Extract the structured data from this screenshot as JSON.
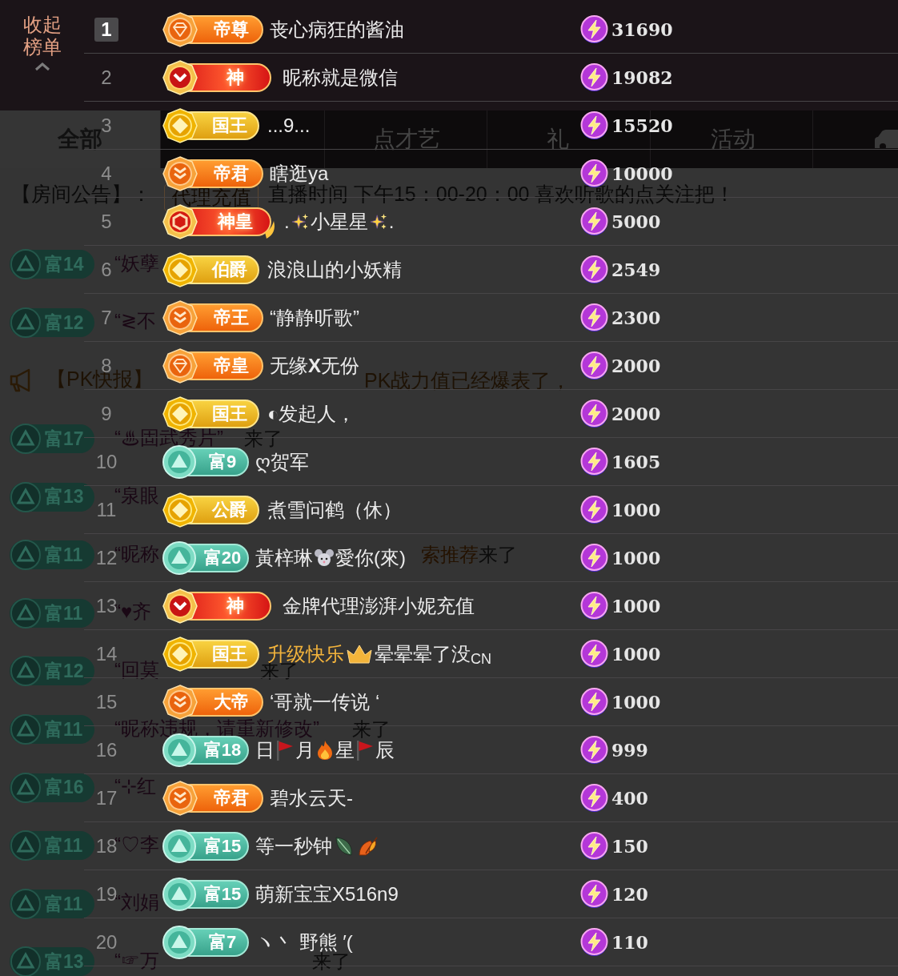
{
  "collapse_button": {
    "label": "收起榜单"
  },
  "tabs": [
    {
      "kind": "text",
      "label": "全部",
      "selected": true
    },
    {
      "kind": "text",
      "selected": false
    },
    {
      "kind": "text",
      "label": "点才艺",
      "selected": false
    },
    {
      "kind": "text",
      "label": "礼",
      "selected": false
    },
    {
      "kind": "text",
      "label": "活动",
      "selected": false
    },
    {
      "kind": "car",
      "selected": false
    }
  ],
  "announcement": {
    "label": "【房间公告】：",
    "tag": "代理充值",
    "text": "直播时间 下午15：00-20：00 喜欢听歌的点关注把！"
  },
  "chat": [
    {
      "kind": "entry",
      "badge": "富14",
      "name": "“妖孽"
    },
    {
      "kind": "entry",
      "badge": "富12",
      "name": "“≷不"
    },
    {
      "kind": "notice",
      "text": "【PK快报】",
      "tail": "PK战力值已经爆表了，"
    },
    {
      "kind": "entry",
      "badge": "富17",
      "name": "“♨固武秀片”",
      "suffix": "来了"
    },
    {
      "kind": "entry",
      "badge": "富13",
      "name": "“泉眼"
    },
    {
      "kind": "entry",
      "badge": "富11",
      "name": "“昵称",
      "source": "索推荐",
      "suffix": "来了"
    },
    {
      "kind": "entry",
      "badge": "富11",
      "name": "“♥齐"
    },
    {
      "kind": "entry",
      "badge": "富12",
      "name": "“回莫",
      "suffix": "来了"
    },
    {
      "kind": "entry",
      "badge": "富11",
      "name": "“昵称违规，请重新修改”",
      "suffix": "来了"
    },
    {
      "kind": "entry",
      "badge": "富16",
      "name": "“⊹红"
    },
    {
      "kind": "entry",
      "badge": "富11",
      "name": "“♡李"
    },
    {
      "kind": "entry",
      "badge": "富11",
      "name": "“刘娟"
    },
    {
      "kind": "entry",
      "badge": "富13",
      "name": "“☞万",
      "suffix": "来了"
    }
  ],
  "ranking": [
    {
      "rank": "1",
      "highlighted": true,
      "badge": {
        "kind": "gem",
        "label": "帝尊"
      },
      "nickname": [
        {
          "kind": "text",
          "text": "丧心病狂的酱油"
        }
      ],
      "score": "31690"
    },
    {
      "rank": "2",
      "highlighted": false,
      "badge": {
        "kind": "crimson",
        "label": "神"
      },
      "nickname": [
        {
          "kind": "text",
          "text": "昵称就是微信"
        }
      ],
      "score": "19082"
    },
    {
      "rank": "3",
      "highlighted": false,
      "badge": {
        "kind": "gold",
        "label": "国王"
      },
      "nickname": [
        {
          "kind": "text",
          "text": "...9..."
        }
      ],
      "score": "15520"
    },
    {
      "rank": "4",
      "highlighted": false,
      "badge": {
        "kind": "chevron",
        "label": "帝君"
      },
      "nickname": [
        {
          "kind": "text",
          "text": "瞎逛ya"
        }
      ],
      "score": "10000"
    },
    {
      "rank": "5",
      "highlighted": false,
      "badge": {
        "kind": "blaze",
        "label": "神皇"
      },
      "nickname": [
        {
          "kind": "text",
          "text": "."
        },
        {
          "kind": "sparkle"
        },
        {
          "kind": "text",
          "text": "小星星"
        },
        {
          "kind": "sparkle"
        },
        {
          "kind": "text",
          "text": "."
        }
      ],
      "score": "5000"
    },
    {
      "rank": "6",
      "highlighted": false,
      "badge": {
        "kind": "gold",
        "label": "伯爵"
      },
      "nickname": [
        {
          "kind": "text",
          "text": "浪浪山的小妖精"
        }
      ],
      "score": "2549"
    },
    {
      "rank": "7",
      "highlighted": false,
      "badge": {
        "kind": "chevron",
        "label": "帝王"
      },
      "nickname": [
        {
          "kind": "text",
          "text": "“静静听歌”"
        }
      ],
      "score": "2300"
    },
    {
      "rank": "8",
      "highlighted": false,
      "badge": {
        "kind": "gem",
        "label": "帝皇"
      },
      "nickname": [
        {
          "kind": "text",
          "text": "无缘**X**无份"
        }
      ],
      "score": "2000"
    },
    {
      "rank": "9",
      "highlighted": false,
      "badge": {
        "kind": "gold",
        "label": "国王"
      },
      "nickname": [
        {
          "kind": "text",
          "text": "◐发起人，"
        }
      ],
      "score": "2000"
    },
    {
      "rank": "10",
      "highlighted": false,
      "badge": {
        "kind": "wealth",
        "label": "富9"
      },
      "nickname": [
        {
          "kind": "text",
          "text": "ღ贺军"
        }
      ],
      "score": "1605"
    },
    {
      "rank": "11",
      "highlighted": false,
      "badge": {
        "kind": "gold",
        "label": "公爵"
      },
      "nickname": [
        {
          "kind": "text",
          "text": "煮雪问鹤（休）"
        }
      ],
      "score": "1000"
    },
    {
      "rank": "12",
      "highlighted": false,
      "badge": {
        "kind": "wealth",
        "label": "富20"
      },
      "nickname": [
        {
          "kind": "text",
          "text": "黃梓琳"
        },
        {
          "kind": "mouse"
        },
        {
          "kind": "text",
          "text": "愛你(來)"
        }
      ],
      "score": "1000"
    },
    {
      "rank": "13",
      "highlighted": false,
      "badge": {
        "kind": "crimson",
        "label": "神"
      },
      "nickname": [
        {
          "kind": "text",
          "text": "金牌代理澎湃小妮充值"
        }
      ],
      "score": "1000"
    },
    {
      "rank": "14",
      "highlighted": false,
      "badge": {
        "kind": "gold",
        "label": "国王"
      },
      "nickname": [
        {
          "kind": "accent",
          "text": "升级快乐"
        },
        {
          "kind": "crown"
        },
        {
          "kind": "text",
          "text": "晕晕晕了没$_{CN}$"
        }
      ],
      "score": "1000"
    },
    {
      "rank": "15",
      "highlighted": false,
      "badge": {
        "kind": "chevron",
        "label": "大帝"
      },
      "nickname": [
        {
          "kind": "text",
          "text": "‘哥就一传说 ‘"
        }
      ],
      "score": "1000"
    },
    {
      "rank": "16",
      "highlighted": false,
      "badge": {
        "kind": "wealth",
        "label": "富18"
      },
      "nickname": [
        {
          "kind": "text",
          "text": "日"
        },
        {
          "kind": "flag"
        },
        {
          "kind": "text",
          "text": "月"
        },
        {
          "kind": "fire"
        },
        {
          "kind": "text",
          "text": "星"
        },
        {
          "kind": "flag"
        },
        {
          "kind": "text",
          "text": "辰"
        }
      ],
      "score": "999"
    },
    {
      "rank": "17",
      "highlighted": false,
      "badge": {
        "kind": "chevron",
        "label": "帝君"
      },
      "nickname": [
        {
          "kind": "text",
          "text": "碧水云天-"
        }
      ],
      "score": "400"
    },
    {
      "rank": "18",
      "highlighted": false,
      "badge": {
        "kind": "wealth",
        "label": "富15"
      },
      "nickname": [
        {
          "kind": "text",
          "text": "等一秒钟"
        },
        {
          "kind": "leaf"
        },
        {
          "kind": "maple"
        }
      ],
      "score": "150"
    },
    {
      "rank": "19",
      "highlighted": false,
      "badge": {
        "kind": "wealth",
        "label": "富15"
      },
      "nickname": [
        {
          "kind": "text",
          "text": "萌新宝宝X516n9"
        }
      ],
      "score": "120"
    },
    {
      "rank": "20",
      "highlighted": false,
      "badge": {
        "kind": "wealth",
        "label": "富7"
      },
      "nickname": [
        {
          "kind": "text",
          "text": "ヽ丶 野熊 ′("
        }
      ],
      "score": "110"
    }
  ]
}
